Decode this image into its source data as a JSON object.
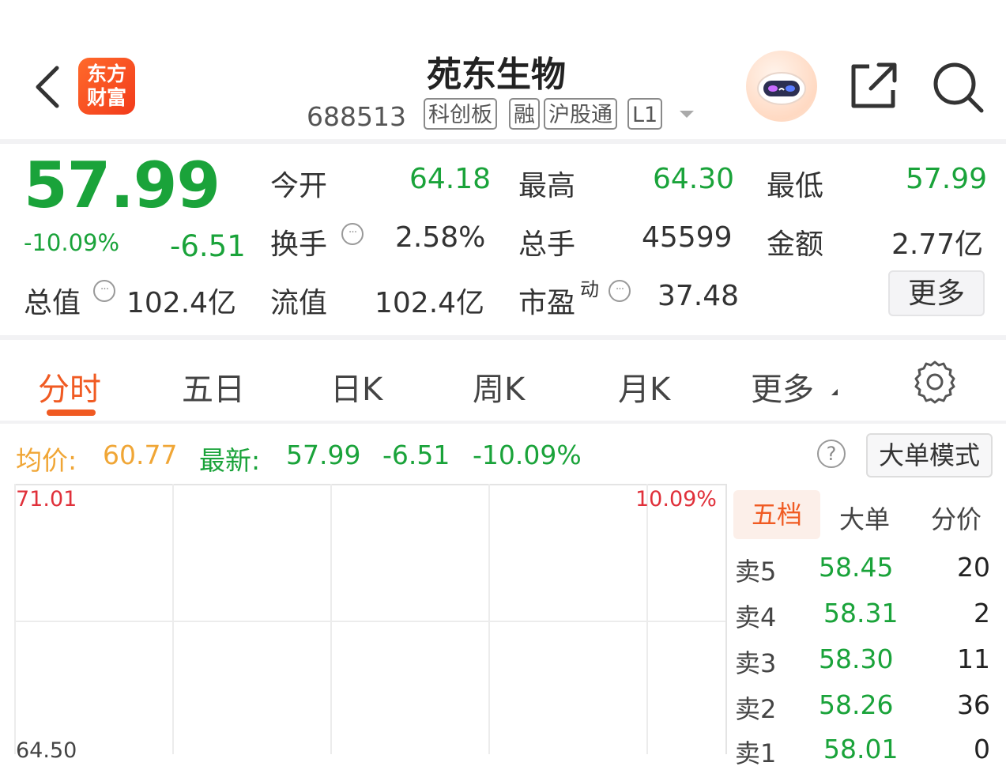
{
  "header": {
    "logo_line1": "东方",
    "logo_line2": "财富",
    "stock_name": "苑东生物",
    "stock_code": "688513",
    "tags": [
      "科创板",
      "融",
      "沪股通",
      "L1"
    ]
  },
  "quote": {
    "price": "57.99",
    "change_pct": "-10.09%",
    "change": "-6.51",
    "fields": {
      "open_label": "今开",
      "open_value": "64.18",
      "high_label": "最高",
      "high_value": "64.30",
      "low_label": "最低",
      "low_value": "57.99",
      "turnover_label": "换手",
      "turnover_value": "2.58%",
      "volume_label": "总手",
      "volume_value": "45599",
      "amount_label": "金额",
      "amount_value": "2.77亿",
      "mktcap_label": "总值",
      "mktcap_value": "102.4亿",
      "float_label": "流值",
      "float_value": "102.4亿",
      "pe_label": "市盈",
      "pe_sup": "动",
      "pe_value": "37.48"
    },
    "more_label": "更多"
  },
  "tabs": [
    "分时",
    "五日",
    "日K",
    "周K",
    "月K",
    "更多"
  ],
  "chart_info": {
    "avg_label": "均价:",
    "avg_value": "60.77",
    "latest_label": "最新:",
    "latest_value": "57.99",
    "latest_change": "-6.51",
    "latest_pct": "-10.09%",
    "big_order_label": "大单模式"
  },
  "chart_axis": {
    "top_left": "71.01",
    "top_right": "10.09%",
    "mid_left": "64.50"
  },
  "orderbook": {
    "tabs": [
      "五档",
      "大单",
      "分价"
    ],
    "rows": [
      {
        "label": "卖5",
        "price": "58.45",
        "volume": "20"
      },
      {
        "label": "卖4",
        "price": "58.31",
        "volume": "2"
      },
      {
        "label": "卖3",
        "price": "58.30",
        "volume": "11"
      },
      {
        "label": "卖2",
        "price": "58.26",
        "volume": "36"
      },
      {
        "label": "卖1",
        "price": "58.01",
        "volume": "0"
      }
    ]
  },
  "colors": {
    "down": "#1aa33a",
    "up": "#e0303a",
    "accent": "#f05a22",
    "avg": "#f0a636"
  }
}
